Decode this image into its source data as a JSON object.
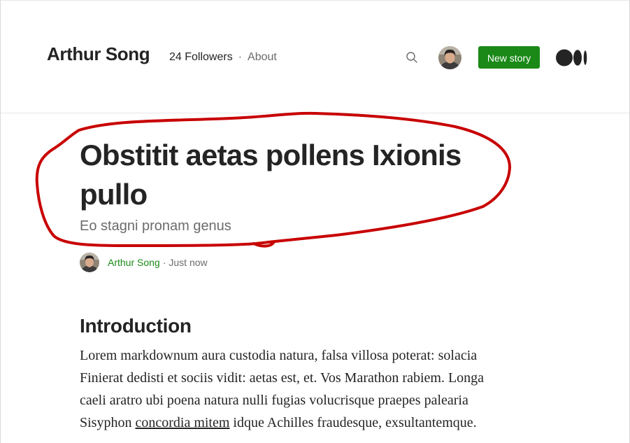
{
  "header": {
    "site_title": "Arthur Song",
    "followers": "24 Followers",
    "separator": "·",
    "about": "About",
    "new_story": "New story",
    "icons": [
      "search-icon",
      "avatar",
      "medium-logo"
    ],
    "accent_color": "#1a8917"
  },
  "article": {
    "title": "Obstitit aetas pollens Ixionis pullo",
    "subtitle": "Eo stagni pronam genus",
    "author": "Arthur Song",
    "author_separator": "·",
    "published": "Just now",
    "section_heading": "Introduction",
    "body": {
      "line1": "Lorem markdownum aura custodia natura, falsa villosa poterat: solacia",
      "line2": "Finierat dedisti et sociis vidit: aetas est, et. Vos Marathon rabiem. Longa",
      "line3": "caeli aratro ubi poena natura nulli fugias volucrisque praepes palearia",
      "line4_before": "Sisyphon ",
      "line4_link": "concordia mitem",
      "line4_after": " idque Achilles fraudesque, exsultantemque."
    }
  },
  "annotation": {
    "type": "hand-drawn ellipse",
    "color": "#c80000"
  }
}
